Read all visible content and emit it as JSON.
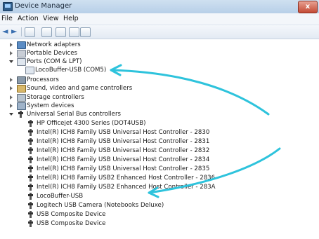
{
  "window": {
    "title": "Device Manager",
    "close_glyph": "x",
    "icon": "device-manager-icon"
  },
  "menu": {
    "file": "File",
    "action": "Action",
    "view": "View",
    "help": "Help"
  },
  "toolbar": {
    "back_glyph": "◄",
    "forward_glyph": "►"
  },
  "tree": {
    "network_adapters": "Network adapters",
    "portable_devices": "Portable Devices",
    "ports": "Ports (COM & LPT)",
    "locobuffer_com": "LocoBuffer-USB (COM5)",
    "processors": "Processors",
    "sound": "Sound, video and game controllers",
    "storage": "Storage controllers",
    "system": "System devices",
    "usb_controllers": "Universal Serial Bus controllers",
    "usb_items": [
      "HP Officejet 4300 Series (DOT4USB)",
      "Intel(R) ICH8 Family USB Universal Host Controller - 2830",
      "Intel(R) ICH8 Family USB Universal Host Controller - 2831",
      "Intel(R) ICH8 Family USB Universal Host Controller - 2832",
      "Intel(R) ICH8 Family USB Universal Host Controller - 2834",
      "Intel(R) ICH8 Family USB Universal Host Controller - 2835",
      "Intel(R) ICH8 Family USB2 Enhanced Host Controller - 2836",
      "Intel(R) ICH8 Family USB2 Enhanced Host Controller - 283A",
      "LocoBuffer-USB",
      "Logitech USB Camera (Notebooks Deluxe)",
      "USB Composite Device",
      "USB Composite Device"
    ]
  },
  "annotation": {
    "arrow_color": "#2ec3dc"
  }
}
